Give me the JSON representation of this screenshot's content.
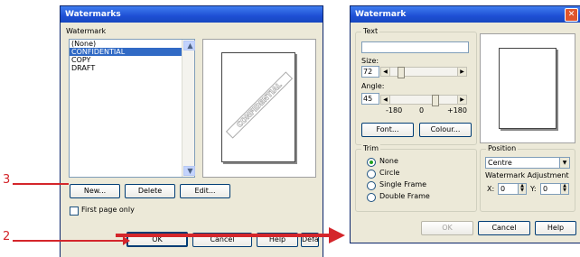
{
  "left_dialog": {
    "title": "Watermarks",
    "list_label": "Watermark",
    "items": [
      "(None)",
      "CONFIDENTIAL",
      "COPY",
      "DRAFT"
    ],
    "selected_index": 1,
    "preview_text": "CONFIDENTIAL",
    "buttons": {
      "new": "New...",
      "delete": "Delete",
      "edit": "Edit...",
      "ok": "OK",
      "cancel": "Cancel",
      "help": "Help",
      "default": "Default"
    },
    "first_page_only": "First page only"
  },
  "right_dialog": {
    "title": "Watermark",
    "text_group": "Text",
    "text_value": "",
    "size_label": "Size:",
    "size_value": "72",
    "angle_label": "Angle:",
    "angle_value": "45",
    "angle_ticks": [
      "-180",
      "0",
      "+180"
    ],
    "font_button": "Font...",
    "colour_button": "Colour...",
    "trim_group": "Trim",
    "trim_options": [
      "None",
      "Circle",
      "Single Frame",
      "Double Frame"
    ],
    "trim_selected": 0,
    "position_group": "Position",
    "position_value": "Centre",
    "adjust_label": "Watermark Adjustment",
    "x_label": "X:",
    "x_value": "0",
    "y_label": "Y:",
    "y_value": "0",
    "buttons": {
      "ok": "OK",
      "cancel": "Cancel",
      "help": "Help"
    }
  },
  "callouts": {
    "c3": "3",
    "c2": "2"
  },
  "colors": {
    "callout": "#d4262b",
    "selection": "#316ac5",
    "title_bar": "#1e4fd4"
  }
}
